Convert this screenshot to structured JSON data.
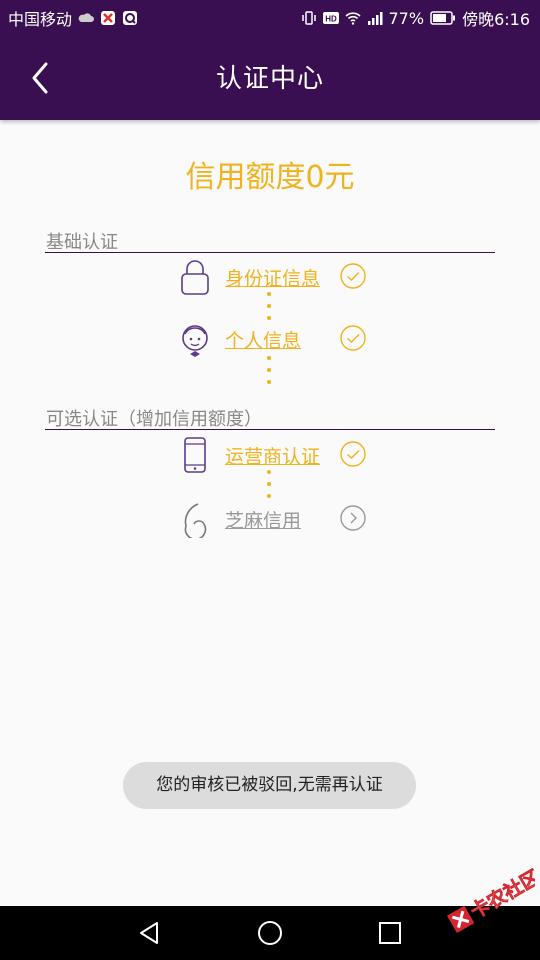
{
  "status_bar": {
    "carrier": "中国移动",
    "battery": "77%",
    "time": "傍晚6:16"
  },
  "header": {
    "title": "认证中心"
  },
  "credit": {
    "text": "信用额度0元"
  },
  "sections": {
    "basic": {
      "title": "基础认证"
    },
    "optional": {
      "title": "可选认证（增加信用额度）"
    }
  },
  "items": [
    {
      "label": "身份证信息",
      "icon": "lock-icon",
      "status": "done"
    },
    {
      "label": "个人信息",
      "icon": "person-icon",
      "status": "done"
    },
    {
      "label": "运营商认证",
      "icon": "phone-icon",
      "status": "done"
    },
    {
      "label": "芝麻信用",
      "icon": "sesame-icon",
      "status": "pending"
    }
  ],
  "toast": {
    "text": "您的审核已被驳回,无需再认证"
  },
  "watermark": {
    "text": "卡农社区"
  },
  "colors": {
    "header": "#3a0f52",
    "accent": "#f0b21d",
    "muted": "#999999"
  }
}
